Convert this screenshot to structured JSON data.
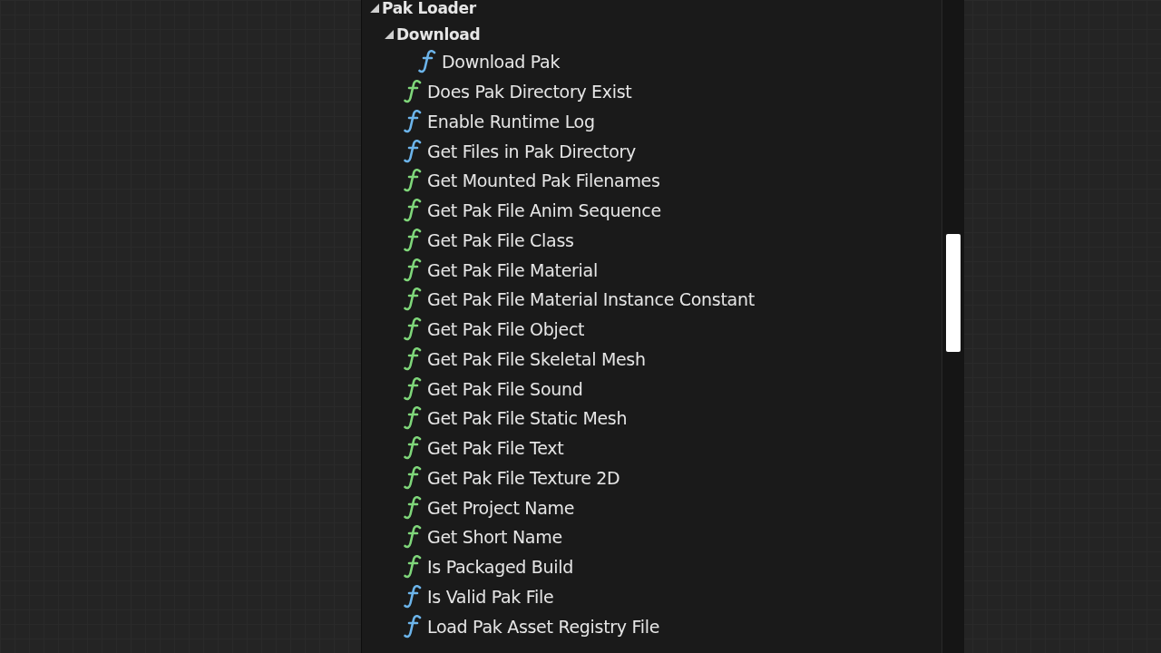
{
  "tree": [
    {
      "label": "Pak Loader",
      "expanded": true,
      "children": [
        {
          "label": "Download",
          "expanded": true,
          "children": [
            {
              "label": "Download Pak",
              "kind": "impure"
            }
          ]
        },
        {
          "label": "Does Pak Directory Exist",
          "kind": "pure"
        },
        {
          "label": "Enable Runtime Log",
          "kind": "impure"
        },
        {
          "label": "Get Files in Pak Directory",
          "kind": "impure"
        },
        {
          "label": "Get Mounted Pak Filenames",
          "kind": "pure"
        },
        {
          "label": "Get Pak File Anim Sequence",
          "kind": "pure"
        },
        {
          "label": "Get Pak File Class",
          "kind": "pure"
        },
        {
          "label": "Get Pak File Material",
          "kind": "pure"
        },
        {
          "label": "Get Pak File Material Instance Constant",
          "kind": "pure"
        },
        {
          "label": "Get Pak File Object",
          "kind": "pure"
        },
        {
          "label": "Get Pak File Skeletal Mesh",
          "kind": "pure"
        },
        {
          "label": "Get Pak File Sound",
          "kind": "pure"
        },
        {
          "label": "Get Pak File Static Mesh",
          "kind": "pure"
        },
        {
          "label": "Get Pak File Text",
          "kind": "pure"
        },
        {
          "label": "Get Pak File Texture 2D",
          "kind": "pure"
        },
        {
          "label": "Get Project Name",
          "kind": "pure"
        },
        {
          "label": "Get Short Name",
          "kind": "pure"
        },
        {
          "label": "Is Packaged Build",
          "kind": "pure"
        },
        {
          "label": "Is Valid Pak File",
          "kind": "impure"
        },
        {
          "label": "Load Pak Asset Registry File",
          "kind": "impure"
        }
      ]
    }
  ]
}
